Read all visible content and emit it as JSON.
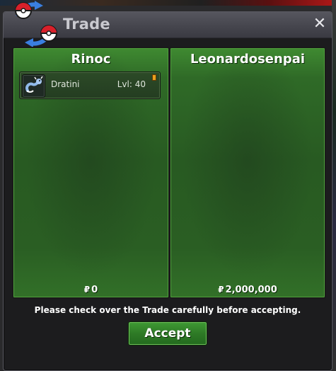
{
  "window": {
    "title": "Trade",
    "close_label": "✕"
  },
  "left_panel": {
    "player": "Rinoc",
    "currency_symbol": "₽",
    "money": "0",
    "items": [
      {
        "name": "Dratini",
        "level": "Lvl: 40"
      }
    ]
  },
  "right_panel": {
    "player": "Leonardosenpai",
    "currency_symbol": "₽",
    "money": "2,000,000",
    "items": []
  },
  "notice": "Please check over the Trade carefully before accepting.",
  "accept_label": "Accept",
  "colors": {
    "panel_green": "#2f6a27",
    "button_green": "#2e7a26",
    "title_text": "#c9c9cf"
  }
}
